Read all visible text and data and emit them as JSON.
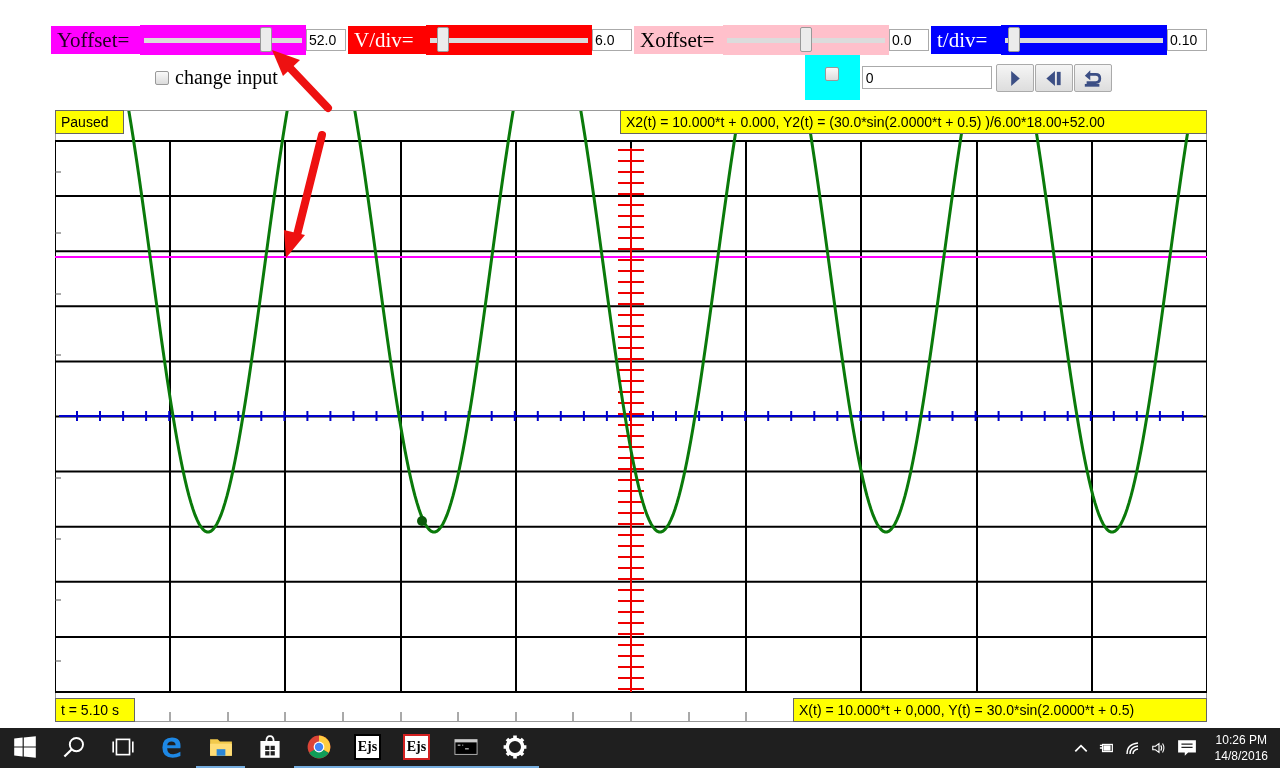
{
  "controls": [
    {
      "label": "Yoffset=",
      "color": "#ff00ff",
      "level": 0.77,
      "value": "52.0"
    },
    {
      "label": "V/div=",
      "color": "#ff0000",
      "level": 0.08,
      "value": "6.0"
    },
    {
      "label": "Xoffset=",
      "color": "#ffc0cb",
      "level": 0.5,
      "value": "0.0"
    },
    {
      "label": "t/div=",
      "color": "#0000ff",
      "level": 0.06,
      "value": "0.10"
    }
  ],
  "change_input": {
    "label": "change input",
    "checked": false
  },
  "run_box": {
    "checked": false
  },
  "step_field": {
    "value": "0"
  },
  "buttons": [
    {
      "kind": "play"
    },
    {
      "kind": "step-back"
    },
    {
      "kind": "reset"
    }
  ],
  "scope": {
    "status": "Paused",
    "trace_formula": "X2(t) = 10.000*t + 0.000, Y2(t) = (30.0*sin(2.0000*t + 0.5) )/6.00*18.00+52.00",
    "time": "t = 5.10 s",
    "signal_formula": "X(t) = 10.000*t + 0,000, Y(t) = 30.0*sin(2.0000*t + 0.5)"
  },
  "taskbar": {
    "items": [
      {
        "kind": "start",
        "running": false
      },
      {
        "kind": "search",
        "running": false
      },
      {
        "kind": "task-view",
        "running": false
      },
      {
        "kind": "edge",
        "running": false
      },
      {
        "kind": "folder",
        "running": true
      },
      {
        "kind": "store",
        "running": false
      },
      {
        "kind": "chrome",
        "running": true
      },
      {
        "kind": "app",
        "label": "Ejs",
        "running": true
      },
      {
        "kind": "app-framed",
        "label": "Ejs",
        "running": true
      },
      {
        "kind": "console",
        "running": true
      },
      {
        "kind": "gear",
        "running": true
      }
    ],
    "time": "10:26 PM",
    "date": "14/8/2016"
  }
}
